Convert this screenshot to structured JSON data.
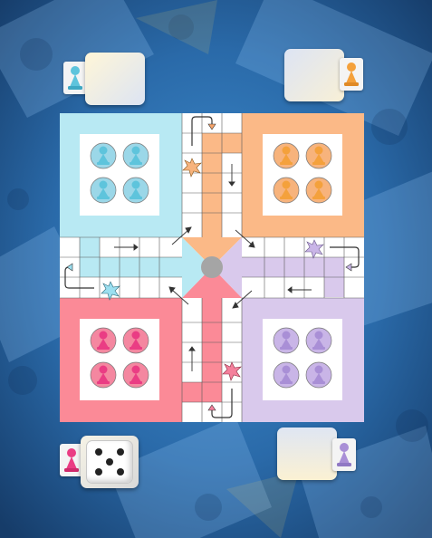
{
  "game": {
    "players": [
      {
        "id": "blue",
        "color": "#5ec4dc",
        "tokens_home": 4,
        "position": "top-left"
      },
      {
        "id": "orange",
        "color": "#f4a13c",
        "tokens_home": 4,
        "position": "top-right"
      },
      {
        "id": "pink",
        "color": "#ea3d84",
        "tokens_home": 4,
        "position": "bottom-left"
      },
      {
        "id": "purple",
        "color": "#a98fd6",
        "tokens_home": 4,
        "position": "bottom-right"
      }
    ],
    "active_player": "pink",
    "dice_value": 5
  },
  "colors": {
    "blue_light": "#b8e9f3",
    "orange_light": "#fbb987",
    "pink_light": "#fb8a97",
    "purple_light": "#d9c9ec",
    "center_dot": "#a5a5a5",
    "star_pink": "#f4809c",
    "star_orange": "#f7b37c",
    "star_blue": "#9bdff0",
    "star_purple": "#c9b5e7"
  },
  "icons": {
    "pawn": "pawn-icon",
    "safe": "star-icon",
    "dice": "dice-icon",
    "direction": "arrow-icon",
    "entry": "curved-arrow-icon"
  }
}
